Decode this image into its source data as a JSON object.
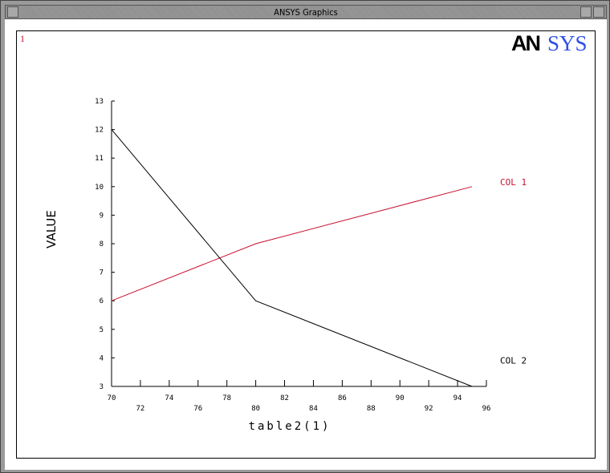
{
  "window": {
    "title": "ANSYS Graphics"
  },
  "window_number": "1",
  "logo": {
    "text_black": "AN",
    "text_blue": "SYS",
    "colors": {
      "black": "#000000",
      "blue": "#3050e8"
    }
  },
  "chart_data": {
    "type": "line",
    "title": "",
    "xlabel": "table2(1)",
    "ylabel": "VALUE",
    "xlim": [
      70,
      96
    ],
    "ylim": [
      3,
      13
    ],
    "x_ticks": [
      "70",
      "72",
      "74",
      "76",
      "78",
      "80",
      "82",
      "84",
      "86",
      "88",
      "90",
      "92",
      "94",
      "96"
    ],
    "y_ticks": [
      "3",
      "4",
      "5",
      "6",
      "7",
      "8",
      "9",
      "10",
      "11",
      "12",
      "13"
    ],
    "grid": false,
    "legend": "right, labels at line ends",
    "series": [
      {
        "name": "COL  1",
        "color": "#c8102e",
        "x": [
          70,
          80,
          95
        ],
        "y": [
          6,
          8,
          10
        ]
      },
      {
        "name": "COL  2",
        "color": "#000000",
        "x": [
          70,
          80,
          95
        ],
        "y": [
          12,
          6,
          3
        ]
      }
    ]
  }
}
